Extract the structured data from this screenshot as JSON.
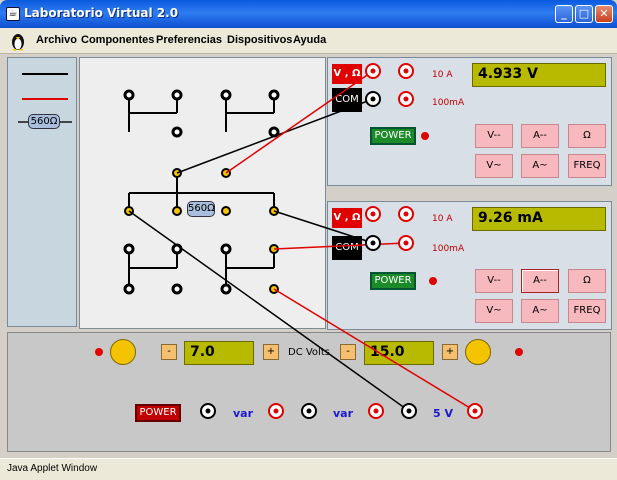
{
  "window": {
    "title": "Laboratorio Virtual 2.0"
  },
  "menu": [
    "Archivo",
    "Componentes",
    "Preferencias",
    "Dispositivos",
    "Ayuda"
  ],
  "palette": {
    "resistor_label": "560Ω"
  },
  "board": {
    "resistor_label": "560Ω"
  },
  "meter1": {
    "vohm_label": "V , Ω",
    "com_label": "COM",
    "range_10a": "10 A",
    "range_100ma": "100mA",
    "display": "4.933 V",
    "power_label": "POWER",
    "buttons": [
      "V--",
      "A--",
      "Ω",
      "V~",
      "A~",
      "FREQ"
    ]
  },
  "meter2": {
    "vohm_label": "V , Ω",
    "com_label": "COM",
    "range_10a": "10 A",
    "range_100ma": "100mA",
    "display": "9.26 mA",
    "power_label": "POWER",
    "buttons": [
      "V--",
      "A--",
      "Ω",
      "V~",
      "A~",
      "FREQ"
    ]
  },
  "supply": {
    "left_value": "7.0",
    "right_value": "15.0",
    "dc_label": "DC Volts",
    "minus": "-",
    "plus": "+",
    "power_label": "POWER",
    "var1": "var",
    "var2": "var",
    "fixed": "5 V"
  },
  "status": "Java Applet Window",
  "colors": {
    "wire_black": "#000000",
    "wire_red": "#e00000",
    "display": "#b8ba00",
    "power_green": "#1d8a2a"
  }
}
